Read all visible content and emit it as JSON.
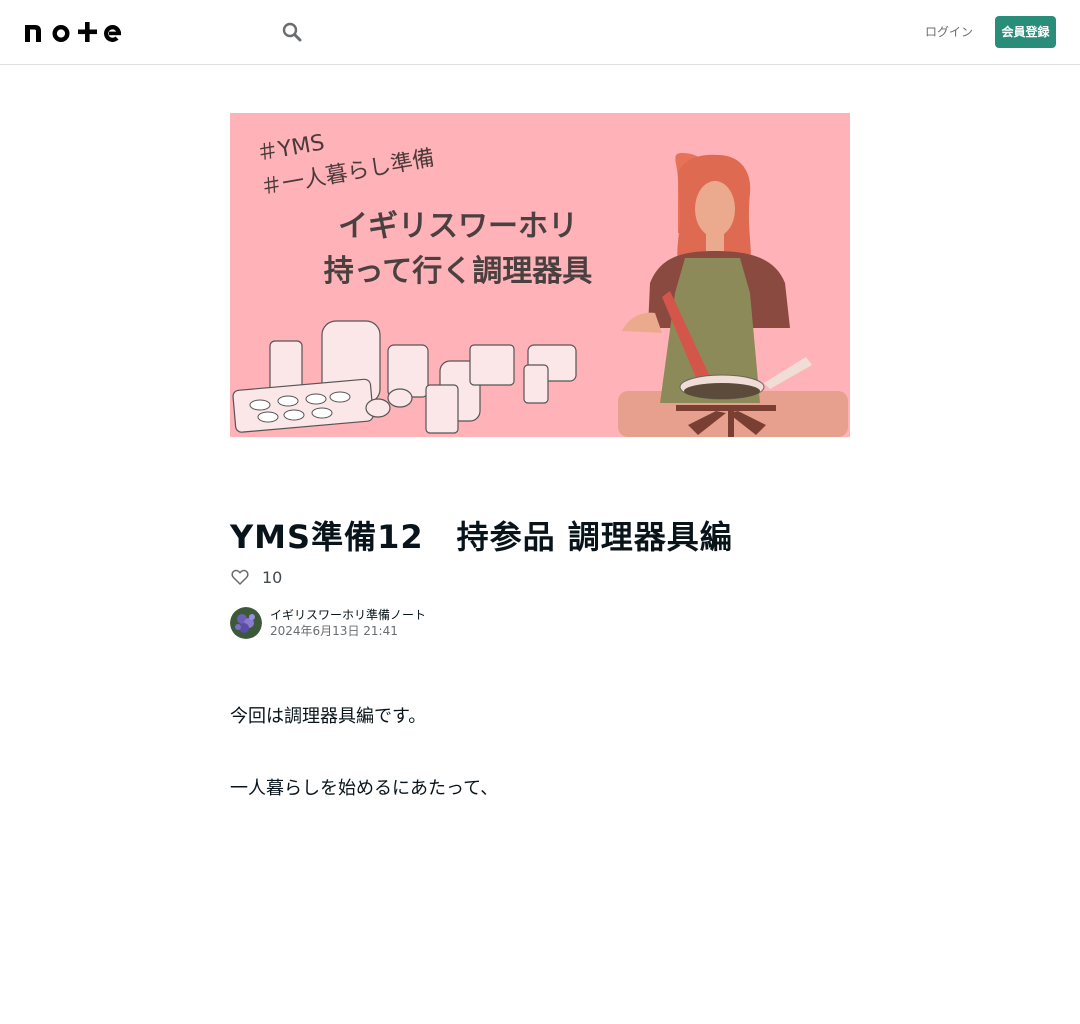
{
  "header": {
    "logo_text": "note",
    "login_label": "ログイン",
    "signup_label": "会員登録"
  },
  "hero": {
    "tag1": "＃YMS",
    "tag2": "＃一人暮らし準備",
    "line1": "イギリスワーホリ",
    "line2": "持って行く調理器具",
    "background_color": "#ffb3b8"
  },
  "article": {
    "title": "YMS準備12　持参品 調理器具編",
    "like_count": "10",
    "author_name": "イギリスワーホリ準備ノート",
    "date": "2024年6月13日 21:41",
    "paragraphs": [
      "今回は調理器具編です。",
      "一人暮らしを始めるにあたって、"
    ]
  },
  "colors": {
    "accent": "#2a8d7a",
    "text": "#08131a",
    "muted": "#6a6d70"
  }
}
